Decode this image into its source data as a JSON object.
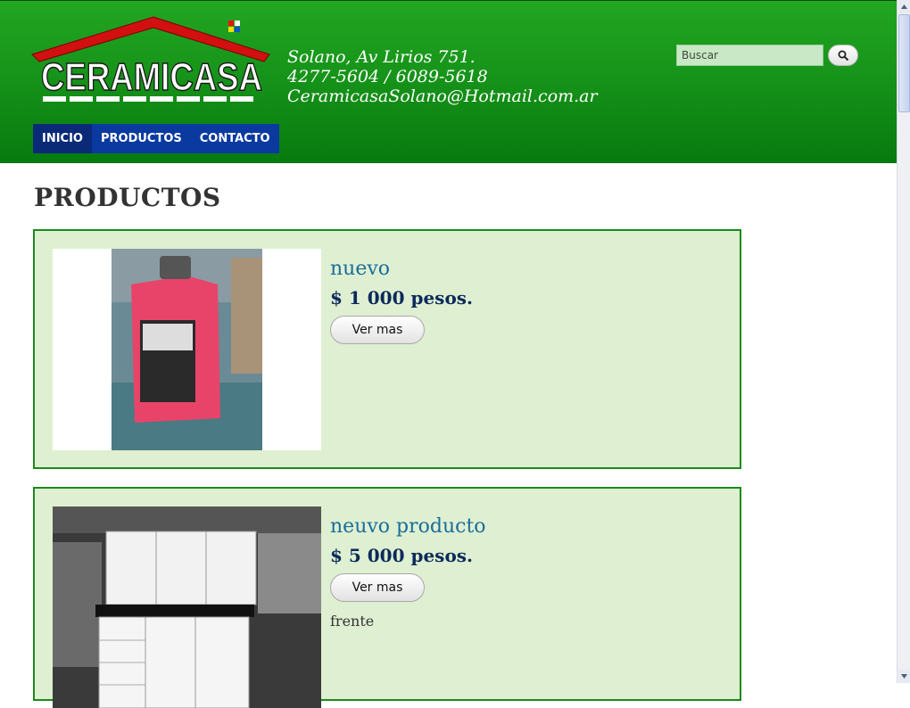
{
  "header": {
    "logo_text": "CERAMICASA",
    "contact": {
      "address": "Solano, Av Lirios 751.",
      "phones": "4277-5604 / 6089-5618",
      "email": "CeramicasaSolano@Hotmail.com.ar"
    },
    "search": {
      "placeholder": "Buscar",
      "icon": "search-icon"
    },
    "nav": [
      {
        "label": "INICIO",
        "active": true
      },
      {
        "label": "PRODUCTOS",
        "active": false
      },
      {
        "label": "CONTACTO",
        "active": false
      }
    ]
  },
  "main": {
    "title": "PRODUCTOS",
    "products": [
      {
        "name": "nuevo",
        "price": "$ 1 000 pesos.",
        "button_label": "Ver mas",
        "description": ""
      },
      {
        "name": "neuvo producto",
        "price": "$ 5 000 pesos.",
        "button_label": "Ver mas",
        "description": "frente"
      }
    ]
  },
  "colors": {
    "header_green": "#17941a",
    "nav_blue": "#0a3aa0",
    "card_bg": "#dff0d2",
    "card_border": "#1a8a1a"
  }
}
